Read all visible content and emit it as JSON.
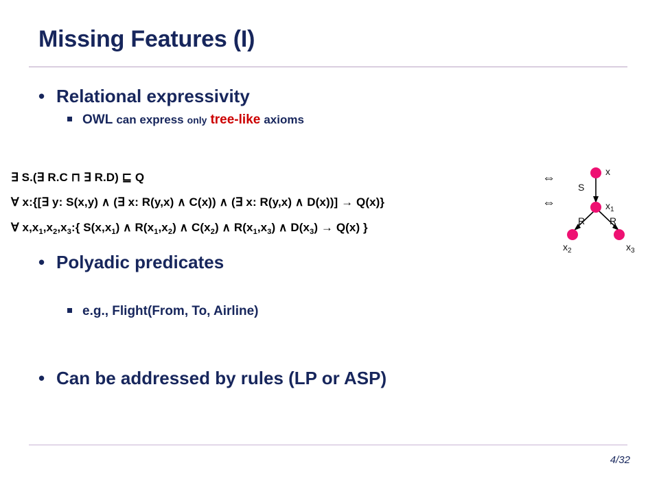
{
  "slide": {
    "title": "Missing Features (I)",
    "page_number": "4/32",
    "title_color": "#17265c",
    "accent_rule_color": "#b9a3c4",
    "highlight_color": "#cc0000",
    "node_color": "#ee1172"
  },
  "bullets": {
    "b1": "Relational expressivity",
    "b1_sub": {
      "part1": "OWL",
      "part2": "can express",
      "part3": "only",
      "part4": "tree-like",
      "part5": "axioms"
    },
    "b2": "Polyadic predicates",
    "b2_sub": "e.g., Flight(From, To, Airline)",
    "b3": "Can be addressed by rules (LP or ASP)"
  },
  "formulas": {
    "line1": "∃ S.(∃ R.C ⊓ ∃ R.D) ⊑ Q",
    "line2_a": "∀ x:{[∃ y: S(x,y) ∧ (∃ x: R(y,x) ∧ C(x)) ∧ (∃ x: R(y,x) ∧ D(x))] → Q(x)}",
    "line3_pre": "∀ x,x",
    "line3_full": "∀ x,x1,x2,x3:{ S(x,x1) ∧ R(x1,x2) ∧ C(x2) ∧ R(x1,x3) ∧ D(x3) → Q(x) }",
    "equiv1": "⇔",
    "equiv2": "⇔"
  },
  "tree": {
    "root_label": "x",
    "edge_s": "S",
    "mid_label": "x",
    "mid_sub": "1",
    "edge_r_left": "R",
    "edge_r_right": "R",
    "leaf_left_label": "x",
    "leaf_left_sub": "2",
    "leaf_right_label": "x",
    "leaf_right_sub": "3"
  }
}
